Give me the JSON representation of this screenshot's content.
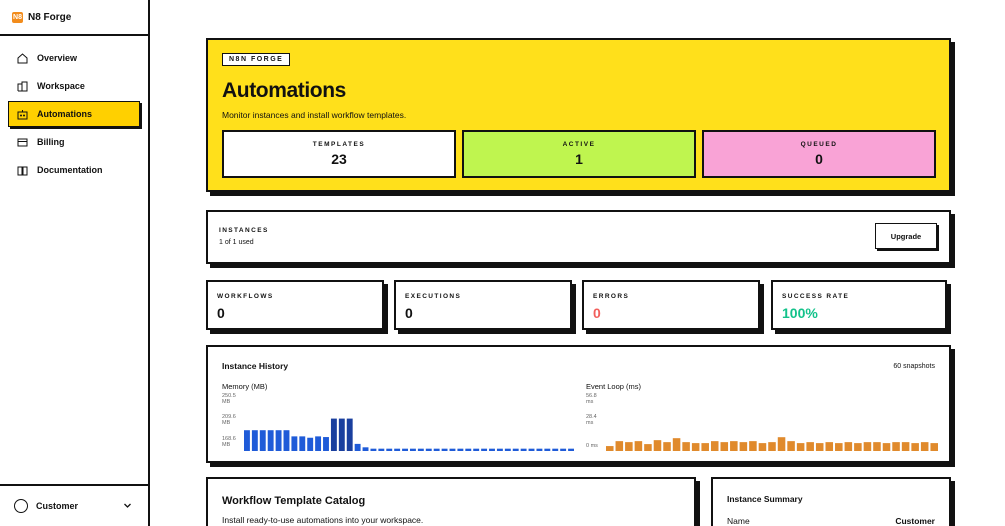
{
  "brand": {
    "name": "N8 Forge",
    "logo_text": "N8"
  },
  "sidebar": {
    "items": [
      {
        "label": "Overview",
        "icon": "home-icon"
      },
      {
        "label": "Workspace",
        "icon": "building-icon"
      },
      {
        "label": "Automations",
        "icon": "automation-icon",
        "active": true
      },
      {
        "label": "Billing",
        "icon": "card-icon"
      },
      {
        "label": "Documentation",
        "icon": "book-icon"
      }
    ],
    "user": {
      "name": "Customer"
    }
  },
  "hero": {
    "tag": "N8N FORGE",
    "title": "Automations",
    "subtitle": "Monitor instances and install workflow templates.",
    "stats": [
      {
        "label": "TEMPLATES",
        "value": "23",
        "color": "#ffffff"
      },
      {
        "label": "ACTIVE",
        "value": "1",
        "color": "#bff54f"
      },
      {
        "label": "QUEUED",
        "value": "0",
        "color": "#f9a3d6"
      }
    ]
  },
  "instances": {
    "label": "INSTANCES",
    "usage": "1 of 1 used",
    "upgrade_label": "Upgrade"
  },
  "metrics": [
    {
      "label": "WORKFLOWS",
      "value": "0",
      "color": "#111111"
    },
    {
      "label": "EXECUTIONS",
      "value": "0",
      "color": "#111111"
    },
    {
      "label": "ERRORS",
      "value": "0",
      "color": "#f25f5c"
    },
    {
      "label": "SUCCESS RATE",
      "value": "100%",
      "color": "#12c28a"
    }
  ],
  "history": {
    "title": "Instance History",
    "count": "60 snapshots",
    "memory": {
      "title": "Memory (MB)",
      "ticks": [
        "250.5 MB",
        "209.6 MB",
        "168.6 MB"
      ]
    },
    "event_loop": {
      "title": "Event Loop (ms)",
      "ticks": [
        "56.8 ms",
        "28.4 ms",
        "0 ms"
      ]
    }
  },
  "catalog": {
    "title": "Workflow Template Catalog",
    "subtitle": "Install ready-to-use automations into your workspace."
  },
  "summary": {
    "title": "Instance Summary",
    "name_label": "Name",
    "name_value": "Customer"
  },
  "chart_data": [
    {
      "type": "bar",
      "title": "Memory (MB)",
      "ylim": [
        168.6,
        250.5
      ],
      "yticks": [
        250.5,
        209.6,
        168.6
      ],
      "color": "#1f5bd8",
      "highlight_color": "#1a3f9e",
      "values": [
        199,
        199,
        199,
        199,
        199,
        199,
        190,
        190,
        188,
        190,
        189,
        216,
        216,
        216,
        179,
        174,
        172,
        172,
        172,
        172,
        172,
        172,
        172,
        172,
        172,
        172,
        172,
        172,
        172,
        172,
        172,
        172,
        172,
        172,
        172,
        172,
        172,
        172,
        172,
        172,
        172,
        172
      ],
      "highlighted": [
        11,
        12,
        13
      ]
    },
    {
      "type": "bar",
      "title": "Event Loop (ms)",
      "ylim": [
        0,
        56.8
      ],
      "yticks": [
        56.8,
        28.4,
        0
      ],
      "color": "#e08a2c",
      "values": [
        5,
        10,
        9,
        10,
        7,
        11,
        9,
        13,
        9,
        8,
        8,
        10,
        9,
        10,
        9,
        10,
        8,
        9,
        14,
        10,
        8,
        9,
        8,
        9,
        8,
        9,
        8,
        9,
        9,
        8,
        9,
        9,
        8,
        9,
        8
      ]
    }
  ]
}
